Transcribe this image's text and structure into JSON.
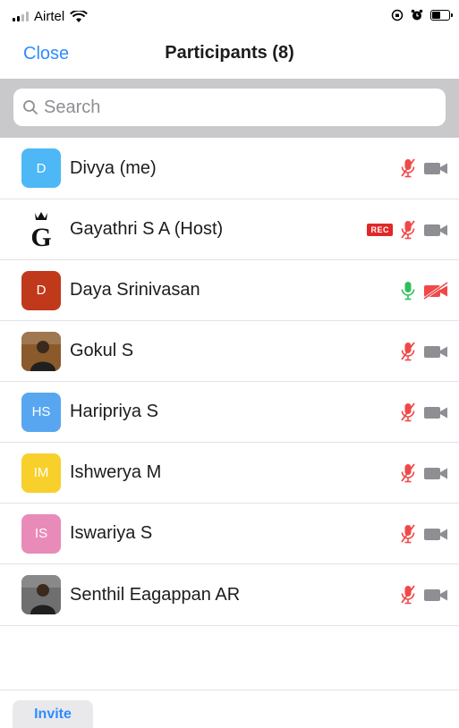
{
  "status_bar": {
    "carrier": "Airtel"
  },
  "nav": {
    "close_label": "Close",
    "title": "Participants (8)"
  },
  "search": {
    "placeholder": "Search"
  },
  "participants": [
    {
      "name": "Divya (me)",
      "avatar_text": "D",
      "avatar_color": "#4db8f5",
      "avatar_kind": "initials",
      "mic": "muted",
      "video": "off",
      "rec": ""
    },
    {
      "name": "Gayathri S A (Host)",
      "avatar_text": "G",
      "avatar_color": "#ffffff",
      "avatar_kind": "crown-logo",
      "mic": "muted",
      "video": "off",
      "rec": "REC"
    },
    {
      "name": "Daya Srinivasan",
      "avatar_text": "D",
      "avatar_color": "#c0391b",
      "avatar_kind": "initials",
      "mic": "on",
      "video": "blocked",
      "rec": ""
    },
    {
      "name": "Gokul S",
      "avatar_text": "",
      "avatar_color": "#8a5a2b",
      "avatar_kind": "photo",
      "mic": "muted",
      "video": "off",
      "rec": ""
    },
    {
      "name": "Haripriya S",
      "avatar_text": "HS",
      "avatar_color": "#58a6f0",
      "avatar_kind": "initials",
      "mic": "muted",
      "video": "off",
      "rec": ""
    },
    {
      "name": "Ishwerya M",
      "avatar_text": "IM",
      "avatar_color": "#f7d02c",
      "avatar_kind": "initials",
      "mic": "muted",
      "video": "off",
      "rec": ""
    },
    {
      "name": "Iswariya S",
      "avatar_text": "IS",
      "avatar_color": "#e98bb8",
      "avatar_kind": "initials",
      "mic": "muted",
      "video": "off",
      "rec": ""
    },
    {
      "name": "Senthil Eagappan AR",
      "avatar_text": "",
      "avatar_color": "#6f6f6f",
      "avatar_kind": "photo",
      "mic": "muted",
      "video": "off",
      "rec": ""
    }
  ],
  "footer": {
    "invite_label": "Invite"
  },
  "colors": {
    "accent": "#2d8cff",
    "muted_red": "#f04848",
    "mic_green": "#2fbf5a",
    "icon_gray": "#8e8e93"
  }
}
